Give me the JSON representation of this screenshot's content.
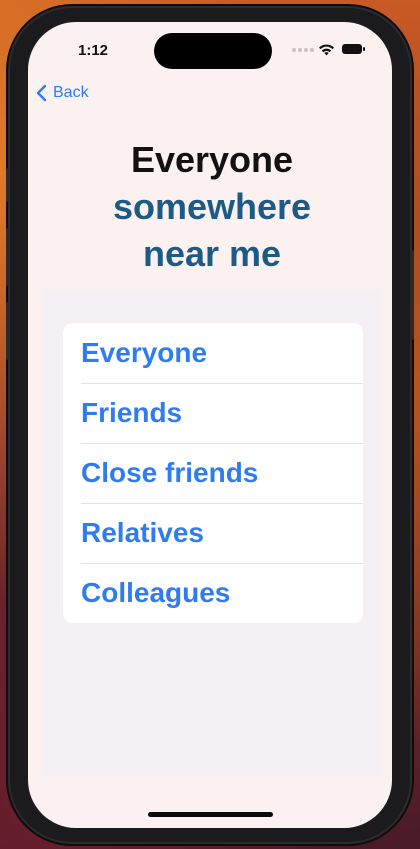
{
  "status_bar": {
    "time": "1:12"
  },
  "nav": {
    "back_label": "Back"
  },
  "header": {
    "line1": "Everyone",
    "line2": "somewhere",
    "line3": "near me"
  },
  "options": [
    {
      "label": "Everyone"
    },
    {
      "label": "Friends"
    },
    {
      "label": "Close friends"
    },
    {
      "label": "Relatives"
    },
    {
      "label": "Colleagues"
    }
  ],
  "colors": {
    "accent": "#2f7cf0",
    "title_dark": "#121212",
    "title_blue": "#1c5b86",
    "screen_bg": "#fcf1f1"
  }
}
